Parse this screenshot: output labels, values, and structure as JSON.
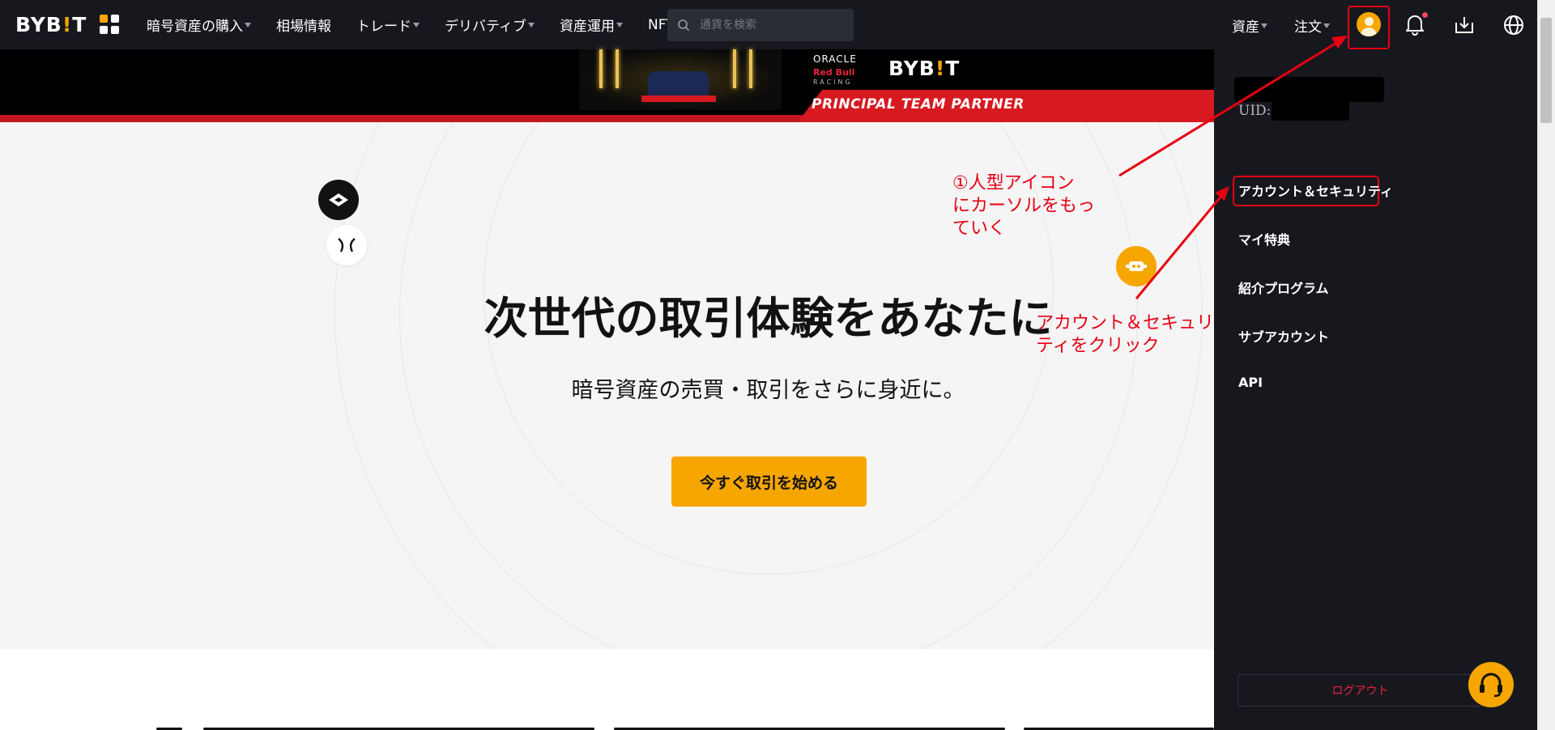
{
  "app": {
    "brand": "BYBIT",
    "brand_pre": "BYB",
    "brand_bang": "!",
    "brand_post": "T"
  },
  "nav": {
    "items": [
      {
        "label": "暗号資産の購入",
        "dropdown": true
      },
      {
        "label": "相場情報",
        "dropdown": false
      },
      {
        "label": "トレード",
        "dropdown": true
      },
      {
        "label": "デリバティブ",
        "dropdown": true
      },
      {
        "label": "資産運用",
        "dropdown": true
      },
      {
        "label": "NFT",
        "dropdown": false
      }
    ],
    "search_placeholder": "通貨を検索",
    "right": {
      "assets_label": "資産",
      "orders_label": "注文"
    },
    "icons": [
      "apps-grid-icon",
      "search-icon",
      "user-avatar-icon",
      "bell-icon",
      "download-icon",
      "globe-icon"
    ]
  },
  "banner": {
    "oracle": "ORACLE",
    "redbull": "Red Bull",
    "racing": "RACING",
    "partner_text": "PRINCIPAL TEAM PARTNER"
  },
  "hero": {
    "title": "次世代の取引体験をあなたに",
    "subtitle": "暗号資産の売買・取引をさらに身近に。",
    "cta_label": "今すぐ取引を始める"
  },
  "account_menu": {
    "uid_label": "UID:",
    "items": [
      {
        "label": "アカウント＆セキュリティ",
        "highlighted": true
      },
      {
        "label": "マイ特典"
      },
      {
        "label": "紹介プログラム"
      },
      {
        "label": "サブアカウント"
      },
      {
        "label": "API"
      }
    ],
    "logout_label": "ログアウト"
  },
  "annotations": {
    "step1_line1": "①人型アイコン",
    "step1_line2": "にカーソルをもっ",
    "step1_line3": "ていく",
    "step2_line1": "アカウント＆セキュリ",
    "step2_line2": "ティをクリック"
  },
  "colors": {
    "nav_bg": "#17181e",
    "accent": "#f7a600",
    "annotation_red": "#e60012",
    "logout_red": "#e8233c",
    "hero_bg": "#f5f5f5"
  }
}
